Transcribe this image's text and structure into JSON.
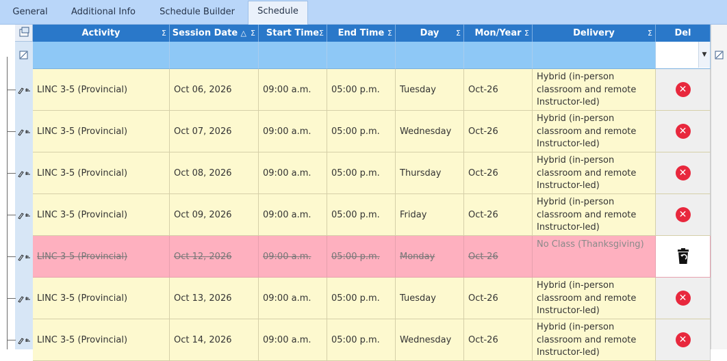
{
  "tabs": [
    {
      "label": "General",
      "active": false
    },
    {
      "label": "Additional Info",
      "active": false
    },
    {
      "label": "Schedule Builder",
      "active": false
    },
    {
      "label": "Schedule",
      "active": true
    }
  ],
  "columns": [
    {
      "key": "activity",
      "label": "Activity",
      "sigma": "Σ",
      "sort": ""
    },
    {
      "key": "session_date",
      "label": "Session Date",
      "sigma": "Σ",
      "sort": "△"
    },
    {
      "key": "start_time",
      "label": "Start Time",
      "sigma": "Σ",
      "sort": ""
    },
    {
      "key": "end_time",
      "label": "End Time",
      "sigma": "Σ",
      "sort": ""
    },
    {
      "key": "day",
      "label": "Day",
      "sigma": "Σ",
      "sort": ""
    },
    {
      "key": "mon_year",
      "label": "Mon/Year",
      "sigma": "Σ",
      "sort": ""
    },
    {
      "key": "delivery",
      "label": "Delivery",
      "sigma": "Σ",
      "sort": ""
    },
    {
      "key": "del",
      "label": "Del",
      "sigma": "",
      "sort": ""
    }
  ],
  "rows": [
    {
      "activity": "LINC 3-5 (Provincial)",
      "session_date": "Oct 06, 2026",
      "start_time": "09:00 a.m.",
      "end_time": "05:00 p.m.",
      "day": "Tuesday",
      "mon_year": "Oct-26",
      "delivery": "Hybrid (in-person\nclassroom and remote\nInstructor-led)",
      "cancelled": false
    },
    {
      "activity": "LINC 3-5 (Provincial)",
      "session_date": "Oct 07, 2026",
      "start_time": "09:00 a.m.",
      "end_time": "05:00 p.m.",
      "day": "Wednesday",
      "mon_year": "Oct-26",
      "delivery": "Hybrid (in-person\nclassroom and remote\nInstructor-led)",
      "cancelled": false
    },
    {
      "activity": "LINC 3-5 (Provincial)",
      "session_date": "Oct 08, 2026",
      "start_time": "09:00 a.m.",
      "end_time": "05:00 p.m.",
      "day": "Thursday",
      "mon_year": "Oct-26",
      "delivery": "Hybrid (in-person\nclassroom and remote\nInstructor-led)",
      "cancelled": false
    },
    {
      "activity": "LINC 3-5 (Provincial)",
      "session_date": "Oct 09, 2026",
      "start_time": "09:00 a.m.",
      "end_time": "05:00 p.m.",
      "day": "Friday",
      "mon_year": "Oct-26",
      "delivery": "Hybrid (in-person\nclassroom and remote\nInstructor-led)",
      "cancelled": false
    },
    {
      "activity": "LINC 3-5 (Provincial)",
      "session_date": "Oct 12, 2026",
      "start_time": "09:00 a.m.",
      "end_time": "05:00 p.m.",
      "day": "Monday",
      "mon_year": "Oct-26",
      "delivery": "No Class (Thanksgiving)",
      "cancelled": true
    },
    {
      "activity": "LINC 3-5 (Provincial)",
      "session_date": "Oct 13, 2026",
      "start_time": "09:00 a.m.",
      "end_time": "05:00 p.m.",
      "day": "Tuesday",
      "mon_year": "Oct-26",
      "delivery": "Hybrid (in-person\nclassroom and remote\nInstructor-led)",
      "cancelled": false
    },
    {
      "activity": "LINC 3-5 (Provincial)",
      "session_date": "Oct 14, 2026",
      "start_time": "09:00 a.m.",
      "end_time": "05:00 p.m.",
      "day": "Wednesday",
      "mon_year": "Oct-26",
      "delivery": "Hybrid (in-person\nclassroom and remote\nInstructor-led)",
      "cancelled": false
    }
  ],
  "icons": {
    "delete": "delete-x-icon",
    "restore": "restore-trash-icon",
    "edit": "edit-pencil-icon",
    "pin": "pin-icon",
    "chooser": "column-chooser-icon",
    "filter_clear": "filter-clear-icon",
    "dropdown": "chevron-down-icon"
  },
  "colors": {
    "header": "#2a78c9",
    "filter": "#8ec8f6",
    "row": "#fdf9cf",
    "cancelled": "#feb0bf",
    "delete": "#e8283d",
    "tabbar": "#b9d6f9"
  }
}
